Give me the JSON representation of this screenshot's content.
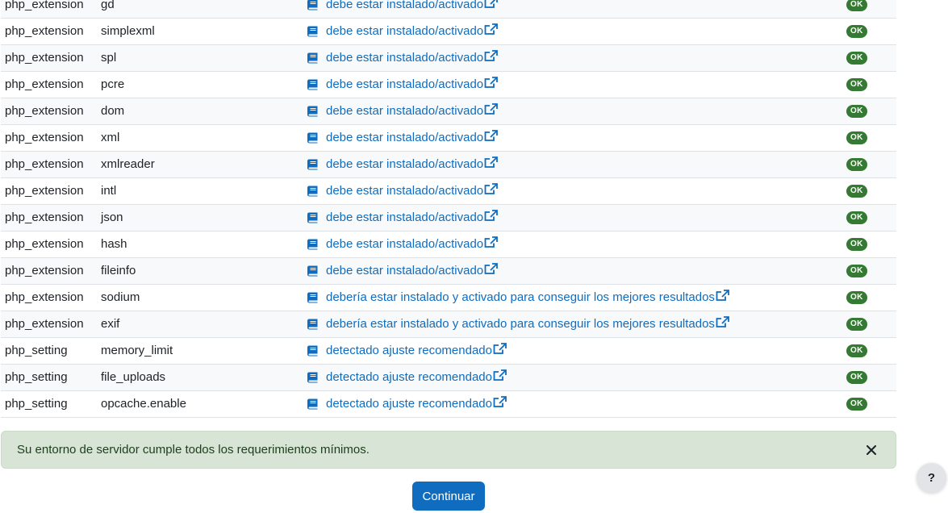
{
  "rows": [
    {
      "type": "php_extension",
      "name": "gd",
      "report": "debe estar instalado/activado",
      "status": "OK"
    },
    {
      "type": "php_extension",
      "name": "simplexml",
      "report": "debe estar instalado/activado",
      "status": "OK"
    },
    {
      "type": "php_extension",
      "name": "spl",
      "report": "debe estar instalado/activado",
      "status": "OK"
    },
    {
      "type": "php_extension",
      "name": "pcre",
      "report": "debe estar instalado/activado",
      "status": "OK"
    },
    {
      "type": "php_extension",
      "name": "dom",
      "report": "debe estar instalado/activado",
      "status": "OK"
    },
    {
      "type": "php_extension",
      "name": "xml",
      "report": "debe estar instalado/activado",
      "status": "OK"
    },
    {
      "type": "php_extension",
      "name": "xmlreader",
      "report": "debe estar instalado/activado",
      "status": "OK"
    },
    {
      "type": "php_extension",
      "name": "intl",
      "report": "debe estar instalado/activado",
      "status": "OK"
    },
    {
      "type": "php_extension",
      "name": "json",
      "report": "debe estar instalado/activado",
      "status": "OK"
    },
    {
      "type": "php_extension",
      "name": "hash",
      "report": "debe estar instalado/activado",
      "status": "OK"
    },
    {
      "type": "php_extension",
      "name": "fileinfo",
      "report": "debe estar instalado/activado",
      "status": "OK"
    },
    {
      "type": "php_extension",
      "name": "sodium",
      "report": "debería estar instalado y activado para conseguir los mejores resultados",
      "status": "OK"
    },
    {
      "type": "php_extension",
      "name": "exif",
      "report": "debería estar instalado y activado para conseguir los mejores resultados",
      "status": "OK"
    },
    {
      "type": "php_setting",
      "name": "memory_limit",
      "report": "detectado ajuste recomendado",
      "status": "OK"
    },
    {
      "type": "php_setting",
      "name": "file_uploads",
      "report": "detectado ajuste recomendado",
      "status": "OK"
    },
    {
      "type": "php_setting",
      "name": "opcache.enable",
      "report": "detectado ajuste recomendado",
      "status": "OK"
    }
  ],
  "alert": {
    "message": "Su entorno de servidor cumple todos los requerimientos mínimos.",
    "close_icon": "close-icon"
  },
  "continue_button": {
    "label": "Continuar"
  },
  "help_button": {
    "label": "?"
  },
  "icons": {
    "doc": "book-icon",
    "external": "external-link-icon"
  },
  "colors": {
    "link": "#0f6cbf",
    "badge_ok": "#357a32",
    "alert_bg": "#d7e4d6",
    "button_primary": "#0f6cbf"
  }
}
